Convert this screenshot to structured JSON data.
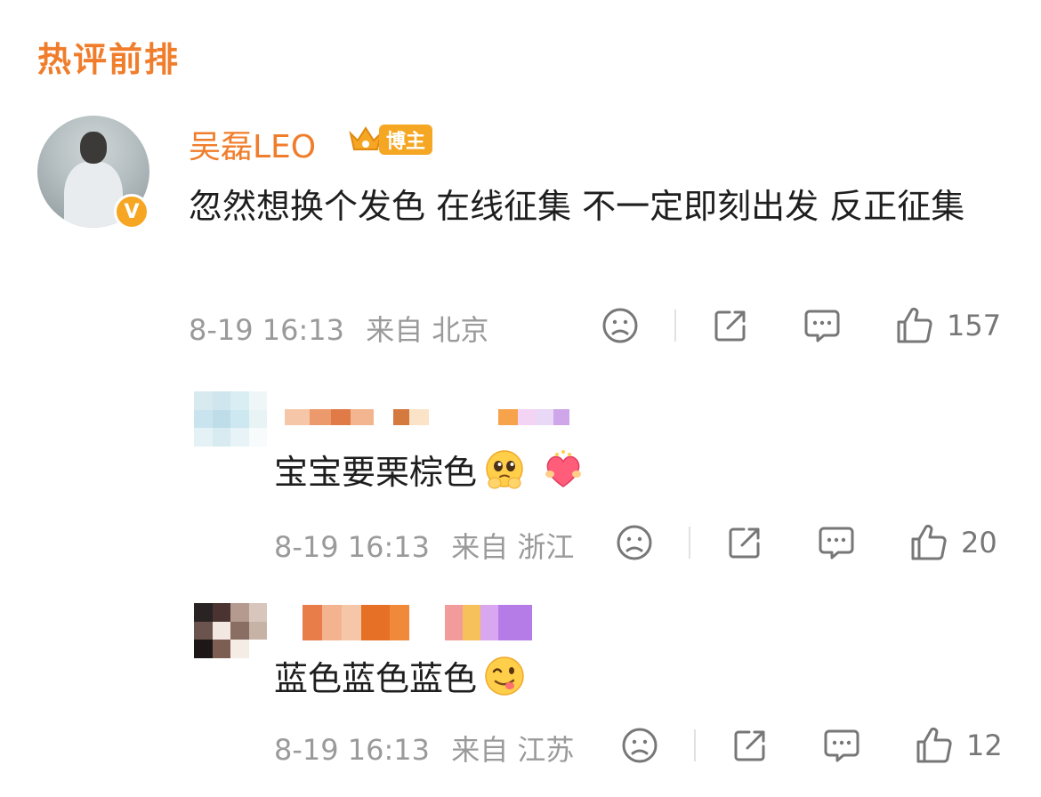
{
  "section_title": "热评前排",
  "main_comment": {
    "username": "吴磊LEO",
    "tag": "博主",
    "verified_mark": "V",
    "text": "忽然想换个发色 在线征集 不一定即刻出发 反正征集",
    "time": "8-19 16:13",
    "source": "来自 北京",
    "likes": "157"
  },
  "replies": [
    {
      "text": "宝宝要栗棕色",
      "time": "8-19 16:13",
      "source": "来自 浙江",
      "likes": "20",
      "emojis": [
        "pleading-face-emoji",
        "heart-hug-emoji"
      ]
    },
    {
      "text": "蓝色蓝色蓝色",
      "time": "8-19 16:13",
      "source": "来自 江苏",
      "likes": "12",
      "emojis": [
        "yummy-face-emoji"
      ]
    }
  ],
  "colors": {
    "accent": "#f07d2b",
    "meta": "#9a9a9a",
    "badge": "#f6a623"
  },
  "icons": [
    "sad-face-icon",
    "share-icon",
    "comment-icon",
    "thumbs-up-icon"
  ]
}
